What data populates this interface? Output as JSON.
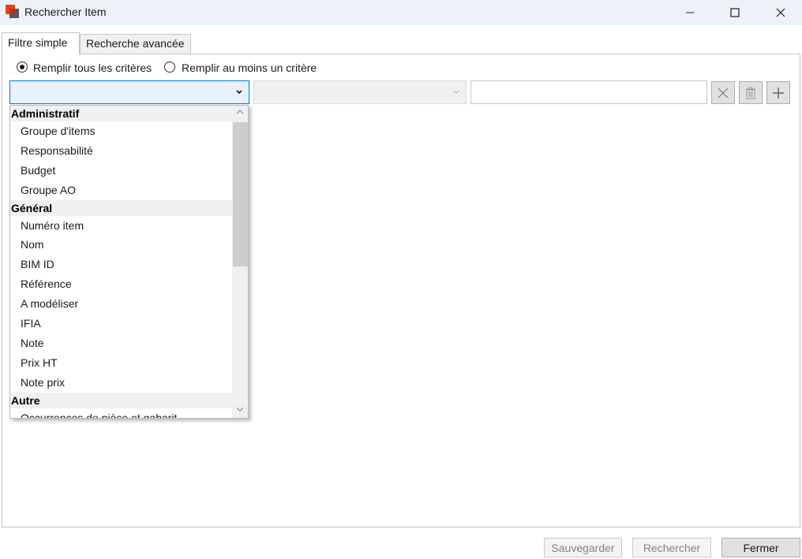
{
  "window": {
    "title": "Rechercher Item",
    "controls": [
      "minimize-icon",
      "maximize-icon",
      "close-icon"
    ]
  },
  "tabs": [
    {
      "label": "Filtre simple",
      "active": true
    },
    {
      "label": "Recherche avancée",
      "active": false
    }
  ],
  "match_mode": {
    "options": [
      {
        "label": "Remplir tous les critères",
        "selected": true
      },
      {
        "label": "Remplir au moins un critère",
        "selected": false
      }
    ]
  },
  "criteria_row": {
    "field_value": "",
    "operator_value": "",
    "value_input": "",
    "buttons": [
      "clear-icon",
      "trash-icon",
      "plus-icon"
    ]
  },
  "field_dropdown": {
    "groups": [
      {
        "label": "Administratif",
        "items": [
          "Groupe d'items",
          "Responsabilité",
          "Budget",
          "Groupe AO"
        ]
      },
      {
        "label": "Général",
        "items": [
          "Numéro item",
          "Nom",
          "BIM ID",
          "Référence",
          "A modéliser",
          "IFIA",
          "Note",
          "Prix HT",
          "Note prix"
        ]
      },
      {
        "label": "Autre",
        "items": [
          "Occurrences de pièce et gabarit"
        ]
      }
    ]
  },
  "footer": {
    "save_label": "Sauvegarder",
    "search_label": "Rechercher",
    "close_label": "Fermer"
  },
  "colors": {
    "titlebar_bg": "#eef2f8",
    "accent_border": "#0078d7",
    "selected_combo_bg": "#e5f1fb",
    "app_icon_red": "#e84118"
  }
}
